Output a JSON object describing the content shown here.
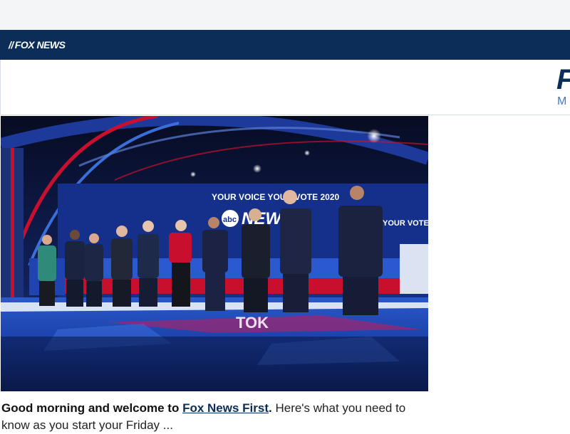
{
  "header": {
    "logo_slash": "//",
    "logo_text": "FOX NEWS",
    "masthead_big": "F",
    "masthead_small": "M"
  },
  "hero": {
    "stage_banner": "YOUR VOICE YOUR VOTE 2020",
    "network_logo": "abc",
    "network_word": "NEWS",
    "podium_text": "YOUR VOTE",
    "floor_text": "TOK"
  },
  "article": {
    "greeting": "Good morning and welcome to",
    "newsletter_link": "Fox News First",
    "period": ".",
    "rest": " Here's what you need to know as you start your Friday ..."
  },
  "colors": {
    "navy": "#0b2d57",
    "link": "#0b2d57",
    "masthead_accent": "#3f7bbf"
  }
}
